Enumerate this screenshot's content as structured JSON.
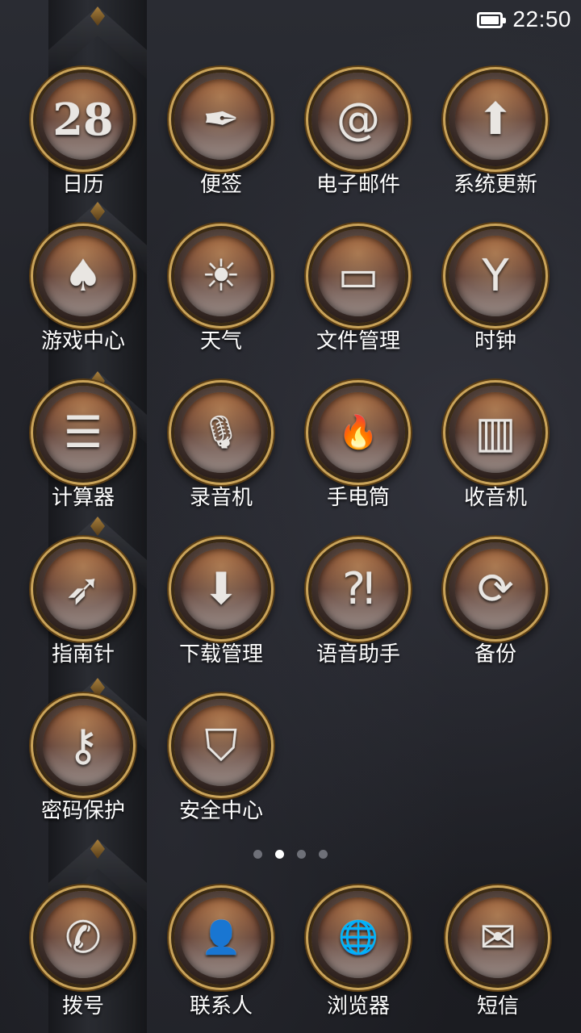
{
  "status_bar": {
    "time": "22:50",
    "battery_icon": "battery-full-icon"
  },
  "apps": [
    {
      "label": "日历",
      "icon": "calendar-icon",
      "glyph": "28"
    },
    {
      "label": "便签",
      "icon": "pen-nib-icon",
      "glyph": "✒"
    },
    {
      "label": "电子邮件",
      "icon": "at-sign-icon",
      "glyph": "@"
    },
    {
      "label": "系统更新",
      "icon": "up-arrow-icon",
      "glyph": "⬆"
    },
    {
      "label": "游戏中心",
      "icon": "spade-icon",
      "glyph": "♠"
    },
    {
      "label": "天气",
      "icon": "sun-icon",
      "glyph": "☀"
    },
    {
      "label": "文件管理",
      "icon": "folder-icon",
      "glyph": "▭"
    },
    {
      "label": "时钟",
      "icon": "clock-icon",
      "glyph": "Y"
    },
    {
      "label": "计算器",
      "icon": "calculator-icon",
      "glyph": "☰"
    },
    {
      "label": "录音机",
      "icon": "microphone-icon",
      "glyph": "🎙"
    },
    {
      "label": "手电筒",
      "icon": "flame-icon",
      "glyph": "🔥"
    },
    {
      "label": "收音机",
      "icon": "radio-icon",
      "glyph": "▥"
    },
    {
      "label": "指南针",
      "icon": "compass-icon",
      "glyph": "➶"
    },
    {
      "label": "下载管理",
      "icon": "download-icon",
      "glyph": "⬇"
    },
    {
      "label": "语音助手",
      "icon": "voice-assistant-icon",
      "glyph": "⁈"
    },
    {
      "label": "备份",
      "icon": "sync-icon",
      "glyph": "⟳"
    },
    {
      "label": "密码保护",
      "icon": "keyhole-icon",
      "glyph": "⚷"
    },
    {
      "label": "安全中心",
      "icon": "shield-icon",
      "glyph": "⛉"
    }
  ],
  "pager": {
    "pages": 4,
    "active_index": 1
  },
  "dock": [
    {
      "label": "拨号",
      "icon": "phone-icon",
      "glyph": "✆"
    },
    {
      "label": "联系人",
      "icon": "contact-person-icon",
      "glyph": "👤"
    },
    {
      "label": "浏览器",
      "icon": "globe-icon",
      "glyph": "🌐"
    },
    {
      "label": "短信",
      "icon": "message-icon",
      "glyph": "✉"
    }
  ]
}
